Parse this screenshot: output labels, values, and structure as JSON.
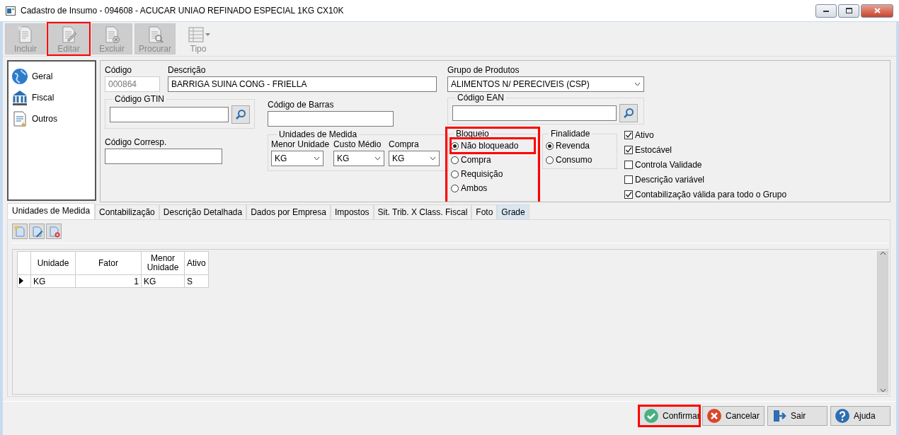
{
  "window": {
    "title": "Cadastro de Insumo - 094608 - ACUCAR UNIAO REFINADO ESPECIAL 1KG CX10K"
  },
  "toolbar": [
    {
      "label": "Incluir",
      "kind": "button",
      "disabled": true,
      "highlighted": false
    },
    {
      "label": "Editar",
      "kind": "button",
      "disabled": true,
      "highlighted": true
    },
    {
      "label": "Excluir",
      "kind": "button",
      "disabled": true,
      "highlighted": false
    },
    {
      "label": "Procurar",
      "kind": "button",
      "disabled": true,
      "highlighted": false
    },
    {
      "label": "Tipo",
      "kind": "dropdown",
      "disabled": true,
      "highlighted": false
    }
  ],
  "sidebar": {
    "items": [
      {
        "label": "Geral"
      },
      {
        "label": "Fiscal"
      },
      {
        "label": "Outros"
      }
    ]
  },
  "form": {
    "codigo": {
      "label": "Código",
      "value": "000864",
      "disabled": true
    },
    "descricao": {
      "label": "Descrição",
      "value": "BARRIGA SUINA CONG - FRIELLA"
    },
    "grupo": {
      "label": "Grupo de Produtos",
      "value": "ALIMENTOS N/ PERECIVEIS  (CSP)"
    },
    "gtin": {
      "label": "Código GTIN"
    },
    "codigo_barras": {
      "label": "Código de Barras"
    },
    "codigo_corresp": {
      "label": "Código Corresp."
    },
    "ean": {
      "label": "Código EAN"
    },
    "unidades": {
      "title": "Unidades de Medida",
      "fields": [
        {
          "label": "Menor Unidade",
          "value": "KG"
        },
        {
          "label": "Custo Médio",
          "value": "KG"
        },
        {
          "label": "Compra",
          "value": "KG"
        }
      ]
    },
    "bloqueio": {
      "title": "Bloqueio",
      "highlighted": true,
      "options": [
        {
          "label": "Não bloqueado",
          "selected": true,
          "highlighted": true
        },
        {
          "label": "Compra",
          "selected": false,
          "highlighted": false
        },
        {
          "label": "Requisição",
          "selected": false,
          "highlighted": false
        },
        {
          "label": "Ambos",
          "selected": false,
          "highlighted": false
        }
      ]
    },
    "finalidade": {
      "title": "Finalidade",
      "options": [
        {
          "label": "Revenda",
          "selected": true
        },
        {
          "label": "Consumo",
          "selected": false
        }
      ]
    },
    "checks": [
      {
        "label": "Ativo",
        "checked": true
      },
      {
        "label": "Estocável",
        "checked": true
      },
      {
        "label": "Controla Validade",
        "checked": false
      },
      {
        "label": "Descrição variável",
        "checked": false
      },
      {
        "label": "Contabilização válida para todo o Grupo",
        "checked": true
      }
    ]
  },
  "tabs": [
    {
      "label": "Unidades de Medida",
      "selected": true,
      "hovered": false
    },
    {
      "label": "Contabilização",
      "selected": false,
      "hovered": false
    },
    {
      "label": "Descrição Detalhada",
      "selected": false,
      "hovered": false
    },
    {
      "label": "Dados por Empresa",
      "selected": false,
      "hovered": false
    },
    {
      "label": "Impostos",
      "selected": false,
      "hovered": false
    },
    {
      "label": "Sit. Trib. X Class. Fiscal",
      "selected": false,
      "hovered": false
    },
    {
      "label": "Foto",
      "selected": false,
      "hovered": false
    },
    {
      "label": "Grade",
      "selected": false,
      "hovered": true
    }
  ],
  "grid": {
    "columns": [
      "Unidade",
      "Fator",
      "Menor Unidade",
      "Ativo"
    ],
    "rows": [
      {
        "current": true,
        "cells": [
          "KG",
          "1",
          "KG",
          "S"
        ]
      }
    ]
  },
  "footer": {
    "buttons": [
      {
        "label": "Confirmar",
        "highlighted": true
      },
      {
        "label": "Cancelar",
        "highlighted": false
      },
      {
        "label": "Sair",
        "highlighted": false
      },
      {
        "label": "Ajuda",
        "highlighted": false
      }
    ]
  }
}
